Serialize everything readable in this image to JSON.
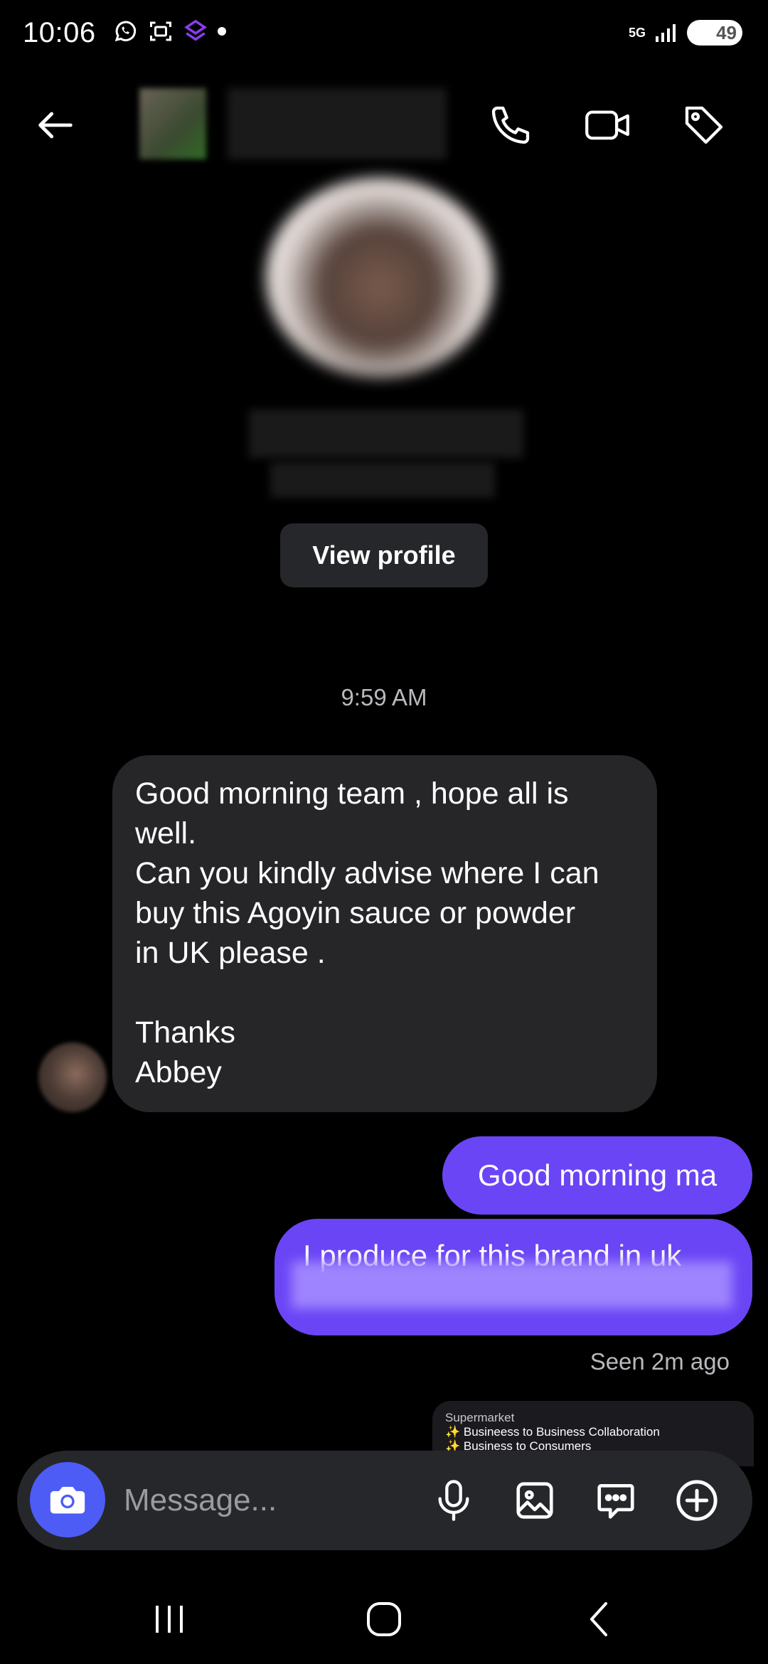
{
  "status_bar": {
    "time": "10:06",
    "network": "5G",
    "battery": "49"
  },
  "header": {
    "back_icon": "arrow-left-icon",
    "call_icon": "phone-icon",
    "video_icon": "video-camera-icon",
    "tag_icon": "tag-icon"
  },
  "profile": {
    "view_profile_label": "View profile"
  },
  "conversation": {
    "timestamp": "9:59 AM",
    "incoming_message": "Good morning team , hope all is\nwell.\nCan you kindly advise where I can\nbuy this Agoyin sauce or powder\nin  UK  please .\n\nThanks\nAbbey",
    "outgoing_messages": [
      "Good morning ma",
      "I produce for this brand in uk"
    ],
    "seen_status": "Seen 2m ago",
    "shared_preview": {
      "title": "Supermarket",
      "lines": [
        "✨ Busineess to Business Collaboration",
        "✨ Business to Consumers"
      ]
    }
  },
  "composer": {
    "placeholder": "Message...",
    "icons": [
      "camera-icon",
      "microphone-icon",
      "gallery-icon",
      "sticker-chat-icon",
      "plus-circle-icon"
    ]
  },
  "nav_bar": {
    "icons": [
      "recent-apps-icon",
      "home-icon",
      "back-icon"
    ]
  },
  "colors": {
    "background": "#000000",
    "incoming_bubble": "#262629",
    "outgoing_bubble": "#6a45f5",
    "camera_button": "#4d5cf5",
    "composer": "#26272b"
  }
}
